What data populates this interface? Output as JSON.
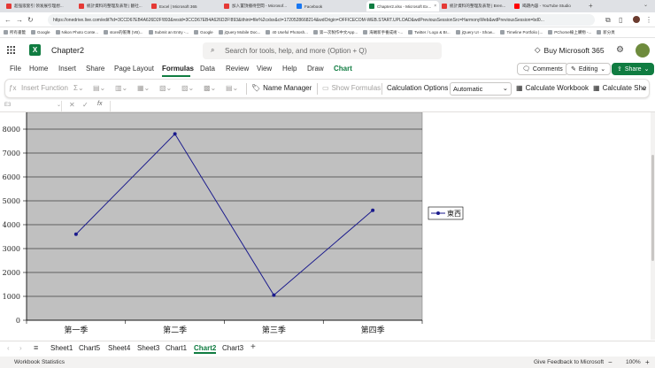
{
  "browser": {
    "tabs": [
      {
        "label": "超强嵌套引 领发展引理想...",
        "color": "#e53935"
      },
      {
        "label": "統計資料的整理及表現 | 翻社...",
        "color": "#e53935"
      },
      {
        "label": "Excel | Microsoft 365",
        "color": "#e53935"
      },
      {
        "label": "加入置頂播待空間 - Microsof...",
        "color": "#e53935"
      },
      {
        "label": "Facebook",
        "color": "#1877f2"
      },
      {
        "label": "Chapter2.xlsx - Microsoft Ex...",
        "color": "#107c41"
      },
      {
        "label": "統計資料的整理及表現 | Bren...",
        "color": "#e53935"
      },
      {
        "label": "喝題內容 - YouTube Studio",
        "color": "#ff0000"
      }
    ],
    "url": "https://onedrive.live.com/edit?id=3CCD67EB4A626D2F!893&resid=3CCD67EB4A626D2F!893&ithint=file%2cxlsx&ct=1720528668214&wdOrigin=OFFICECOM-WEB.START.UPLOAD&wdPreviousSessionSrc=HarmonyWeb&wdPreviousSession=bd0...",
    "bookmarks": [
      "所有書籤",
      "Google",
      "Nikon Photo Conte...",
      "store的帳簿 (VB)...",
      "Submit an Entry -...",
      "Google",
      "jQuery Mobile Doc...",
      "40 Useful Photosh...",
      "第一次製作中文App...",
      "海賊新手養成術 -...",
      "Twitter / Logo & Br...",
      "jQuery UI - Show...",
      "Timeline Portfolio |...",
      "PChome線上購物 -...",
      "新分頁"
    ]
  },
  "app": {
    "logo_letter": "X",
    "doc_title": "Chapter2",
    "search_placeholder": "Search for tools, help, and more (Option + Q)",
    "buy_label": "Buy Microsoft 365"
  },
  "ribbon": {
    "tabs": [
      "File",
      "Home",
      "Insert",
      "Share",
      "Page Layout",
      "Formulas",
      "Data",
      "Review",
      "View",
      "Help",
      "Draw",
      "Chart"
    ],
    "active_tab": "Formulas",
    "comments_label": "Comments",
    "editing_label": "Editing",
    "share_label": "Share"
  },
  "toolbar": {
    "insert_function": "Insert Function",
    "name_manager": "Name Manager",
    "show_formulas": "Show Formulas",
    "calculation_options": "Calculation Options",
    "calculation_value": "Automatic",
    "calculate_workbook": "Calculate Workbook",
    "calculate_sheet": "Calculate She"
  },
  "formula_bar": {
    "name_box": "E3",
    "fx": "fx"
  },
  "sheets": {
    "tabs": [
      "Sheet1",
      "Chart5",
      "Sheet4",
      "Sheet3",
      "Chart1",
      "Chart2",
      "Chart3"
    ],
    "active": "Chart2"
  },
  "status": {
    "left": "Workbook Statistics",
    "feedback": "Give Feedback to Microsoft",
    "zoom": "100%"
  },
  "chart_data": {
    "type": "line",
    "categories": [
      "第一季",
      "第二季",
      "第三季",
      "第四季"
    ],
    "series": [
      {
        "name": "東西",
        "values": [
          3600,
          7800,
          1050,
          4600
        ]
      }
    ],
    "yticks": [
      0,
      1000,
      2000,
      3000,
      4000,
      5000,
      6000,
      7000,
      8000
    ],
    "ylim": [
      0,
      8000
    ],
    "grid": true,
    "legend": "right",
    "colors": {
      "line": "#1a1a8c",
      "plot_bg": "#c0c0c0"
    }
  }
}
